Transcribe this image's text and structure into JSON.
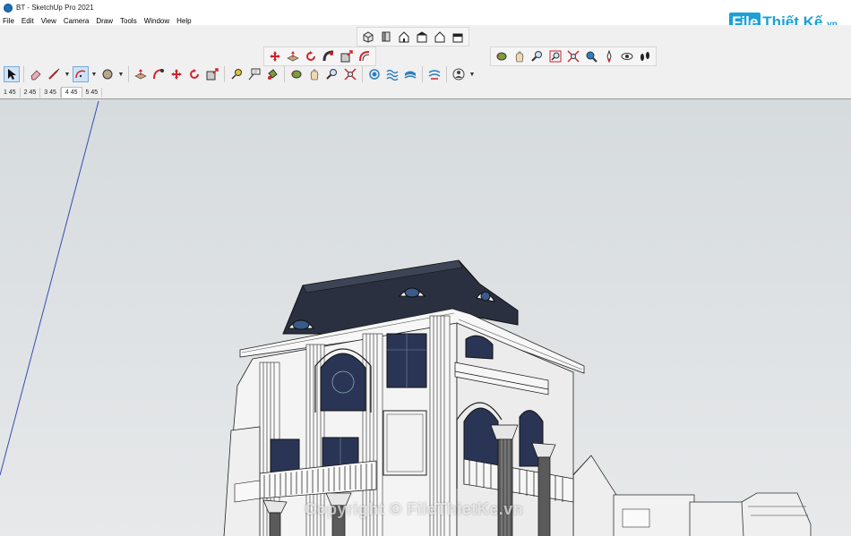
{
  "window": {
    "title": "BT - SketchUp Pro 2021"
  },
  "menu": [
    "File",
    "Edit",
    "View",
    "Camera",
    "Draw",
    "Tools",
    "Window",
    "Help"
  ],
  "scenes": {
    "tabs": [
      "1 45",
      "2 45",
      "3 45",
      "4 45",
      "5 45"
    ],
    "active_index": 3
  },
  "toolbars": {
    "views": [
      "iso-view-icon",
      "top-view-icon",
      "front-view-icon",
      "right-view-icon",
      "back-view-icon",
      "left-view-icon"
    ],
    "edit": [
      "move-icon",
      "push-pull-icon",
      "rotate-icon",
      "follow-me-icon",
      "scale-icon",
      "offset-icon"
    ],
    "camera": [
      "orbit-icon",
      "pan-icon",
      "zoom-icon",
      "zoom-window-icon",
      "zoom-extents-icon",
      "position-camera-icon",
      "walk-icon",
      "look-around-icon",
      "footprints-icon"
    ],
    "main": [
      "select-icon",
      "eraser-icon",
      "line-icon",
      "arc-icon",
      "shape-icon",
      "push-pull-icon",
      "follow-me-icon",
      "move-icon",
      "rotate-icon",
      "scale-icon",
      "tape-measure-icon",
      "text-icon",
      "paint-bucket-icon",
      "orbit-icon",
      "pan-icon",
      "zoom-icon",
      "zoom-extents-icon",
      "sandbox-icon",
      "sandbox-smoove-icon",
      "sandbox-stamp-icon",
      "sandbox-drape-icon",
      "user-icon"
    ]
  },
  "logo": {
    "part1": "File",
    "part2": "Thiết Kế",
    "tld": ".vn"
  },
  "watermark": "Copyright © FileThietKe.vn",
  "colors": {
    "accent": "#1ba1d6",
    "sky_top": "#d6dbde",
    "sky_bottom": "#e7e9ea",
    "roof": "#2a3040",
    "walls": "#f4f4f4"
  }
}
